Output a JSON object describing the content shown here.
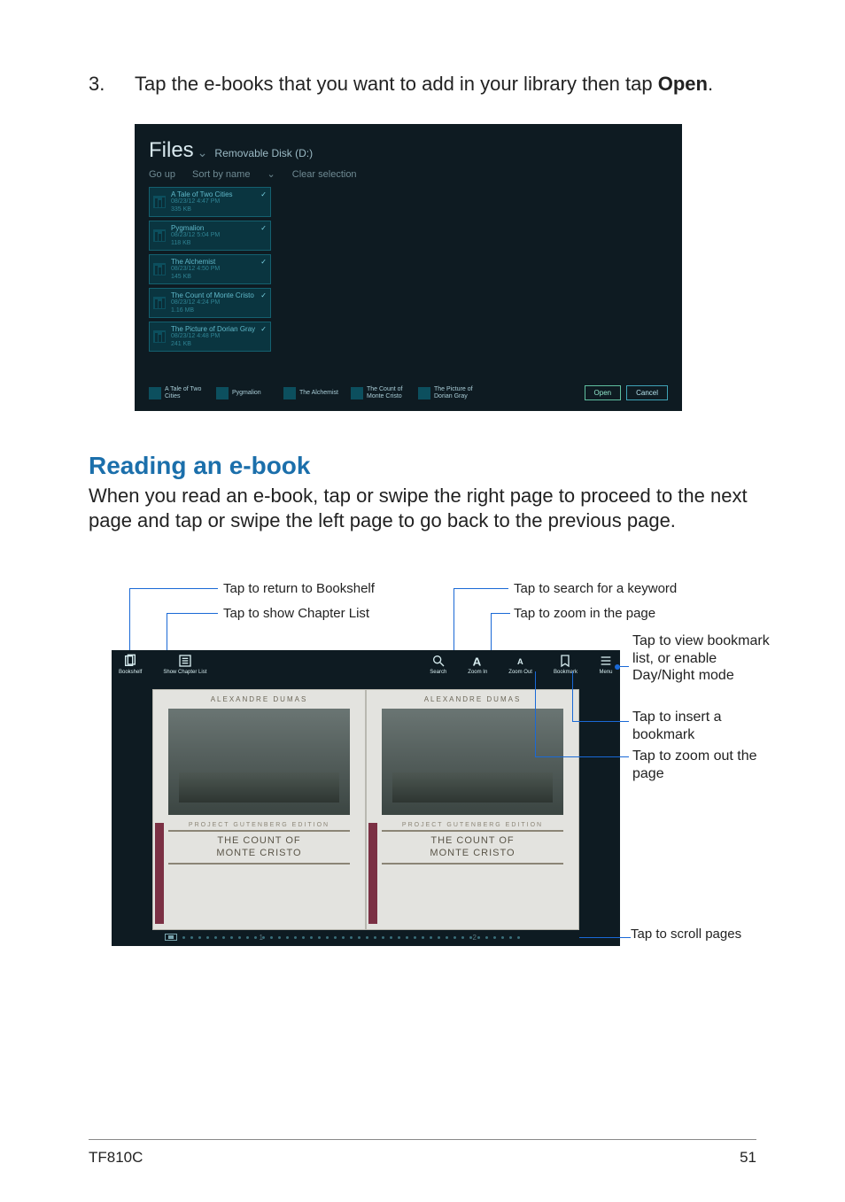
{
  "step": {
    "number": "3.",
    "text_prefix": "Tap the e-books that you want to add in your library then tap ",
    "bold": "Open",
    "text_suffix": "."
  },
  "files": {
    "title": "Files",
    "location": "Removable Disk (D:)",
    "controls": {
      "go_up": "Go up",
      "sort": "Sort by name",
      "clear": "Clear selection"
    },
    "items": [
      {
        "title": "A Tale of Two Cities",
        "meta": "08/23/12 4:47 PM",
        "size": "335 KB"
      },
      {
        "title": "Pygmalion",
        "meta": "08/23/12 5:04 PM",
        "size": "118 KB"
      },
      {
        "title": "The Alchemist",
        "meta": "08/23/12 4:50 PM",
        "size": "145 KB"
      },
      {
        "title": "The Count of Monte Cristo",
        "meta": "08/23/12 4:24 PM",
        "size": "1.16 MB"
      },
      {
        "title": "The Picture of Dorian Gray",
        "meta": "08/23/12 4:48 PM",
        "size": "241 KB"
      }
    ],
    "selected": [
      "A Tale of Two Cities",
      "Pygmalion",
      "The Alchemist",
      "The Count of Monte Cristo",
      "The Picture of Dorian Gray"
    ],
    "buttons": {
      "open": "Open",
      "cancel": "Cancel"
    }
  },
  "section": {
    "heading": "Reading an e-book",
    "paragraph": "When you read an e-book, tap or swipe the right page to proceed to the next page and tap or swipe the left page to go back to the previous page."
  },
  "reader": {
    "toolbar": {
      "bookshelf": "Bookshelf",
      "chapter_list": "Show Chapter List",
      "search": "Search",
      "zoom_in": "Zoom In",
      "zoom_out": "Zoom Out",
      "bookmark": "Bookmark",
      "menu": "Menu"
    },
    "page": {
      "author": "ALEXANDRE DUMAS",
      "edition": "PROJECT GUTENBERG EDITION",
      "title_line1": "THE COUNT OF",
      "title_line2": "MONTE CRISTO",
      "num1": "1",
      "num2": "2"
    },
    "callouts": {
      "bookshelf": "Tap to return to Bookshelf",
      "chapter": "Tap to show Chapter List",
      "search": "Tap to search for a keyword",
      "zoomin": "Tap to zoom in the page",
      "menu": "Tap to view bookmark list, or enable Day/Night mode",
      "bookmark": "Tap to insert a bookmark",
      "zoomout": "Tap to zoom out the page",
      "scroll": "Tap to scroll pages"
    }
  },
  "footer": {
    "model": "TF810C",
    "page": "51"
  }
}
